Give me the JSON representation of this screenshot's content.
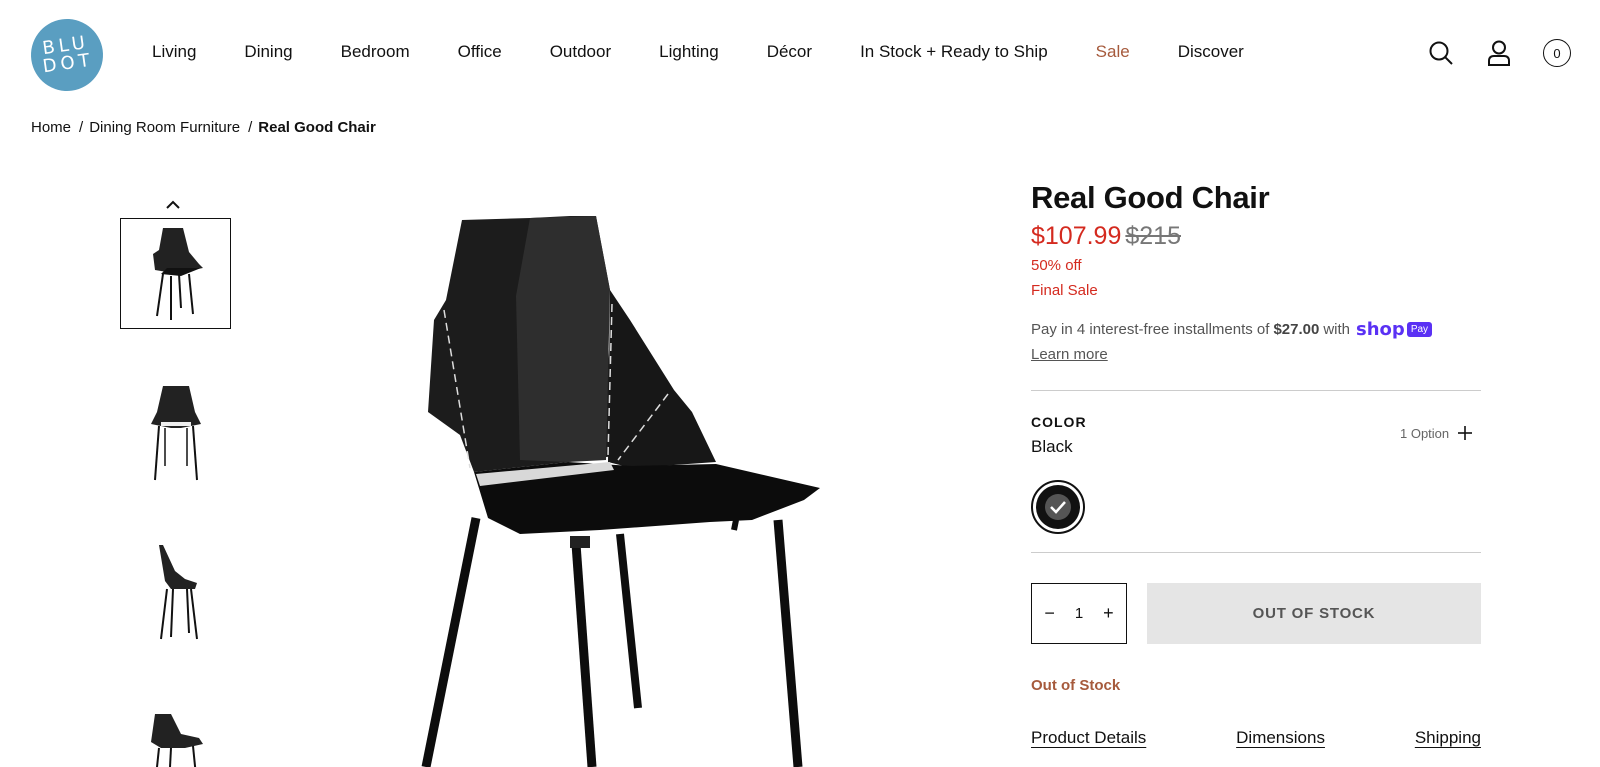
{
  "brand": {
    "logo_lines": [
      "BLU",
      "DOT"
    ]
  },
  "nav": {
    "items": [
      "Living",
      "Dining",
      "Bedroom",
      "Office",
      "Outdoor",
      "Lighting",
      "Décor",
      "In Stock + Ready to Ship",
      "Sale",
      "Discover"
    ]
  },
  "header": {
    "cart_count": "0",
    "icons": [
      "search-icon",
      "account-icon",
      "cart-icon"
    ]
  },
  "breadcrumb": {
    "items": [
      "Home",
      "Dining Room Furniture",
      "Real Good Chair"
    ],
    "separator": "/"
  },
  "gallery": {
    "thumbnails": [
      "front-three-quarter",
      "front",
      "side",
      "three-quarter"
    ],
    "active_index": 0
  },
  "product": {
    "title": "Real Good Chair",
    "price_sale": "$107.99",
    "price_original": "$215",
    "discount": "50% off",
    "final_sale": "Final Sale",
    "installments_prefix": "Pay in 4 interest-free installments of",
    "installments_amount": "$27.00",
    "installments_with": "with",
    "shop_pay_word": "shop",
    "shop_pay_badge": "Pay",
    "learn_more": "Learn more",
    "color_label": "COLOR",
    "color_value": "Black",
    "color_options": "1 Option",
    "quantity": "1",
    "cta_label": "OUT OF STOCK",
    "stock_status": "Out of Stock",
    "tabs": [
      "Product Details",
      "Dimensions",
      "Shipping"
    ]
  },
  "colors": {
    "sale_red": "#d42a1f",
    "logo_blue": "#5a9ec1",
    "sale_nav": "#a65a3c",
    "shop_pay": "#5a31f4"
  }
}
